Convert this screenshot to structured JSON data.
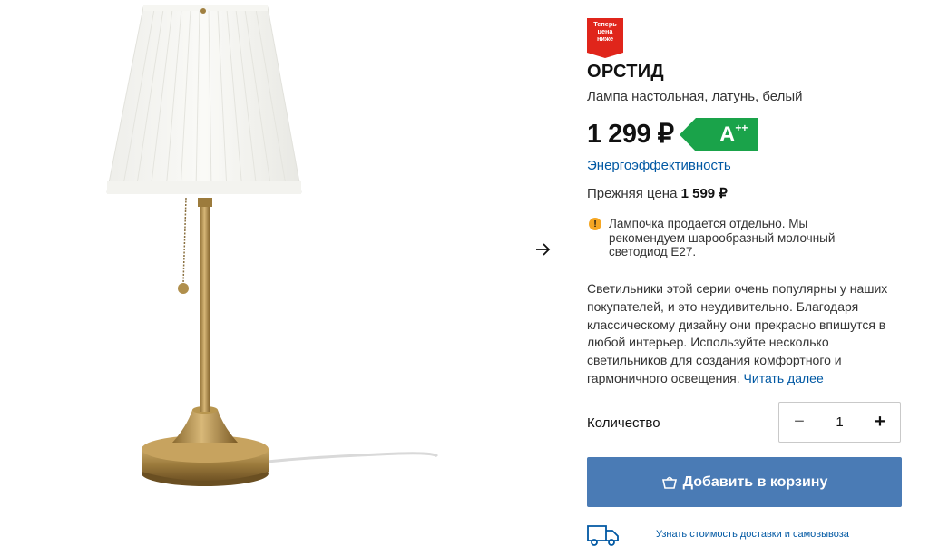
{
  "badge": {
    "lines": [
      "Теперь",
      "цена",
      "ниже"
    ],
    "color": "#e0251b"
  },
  "product": {
    "name": "ОРСТИД",
    "description": "Лампа настольная, латунь, белый",
    "price": "1 299 ₽",
    "energy_grade": "A",
    "energy_grade_suffix": "++",
    "energy_color": "#1aa34a",
    "energy_link": "Энергоэффективность",
    "old_price_label": "Прежняя цена",
    "old_price": "1 599 ₽"
  },
  "notice": {
    "icon": "warning-icon",
    "text": "Лампочка продается отдельно. Мы рекомендуем шарообразный молочный светодиод E27."
  },
  "details": {
    "text": "Светильники этой серии очень популярны у наших покупателей, и это неудивительно. Благодаря классическому дизайну они прекрасно впишутся в любой интерьер. Используйте несколько светильников для создания комфортного и гармоничного освещения.",
    "read_more": "Читать далее"
  },
  "quantity": {
    "label": "Количество",
    "minus": "−",
    "value": "1",
    "plus": "+"
  },
  "cart": {
    "label": "Добавить в корзину",
    "icon": "shopping-bag-icon",
    "color": "#4a7bb5"
  },
  "delivery": {
    "icon": "truck-icon",
    "link": "Узнать стоимость доставки и самовывоза"
  },
  "gallery": {
    "next_icon": "arrow-right-icon"
  },
  "colors": {
    "link": "#0058a3",
    "text": "#111111"
  }
}
